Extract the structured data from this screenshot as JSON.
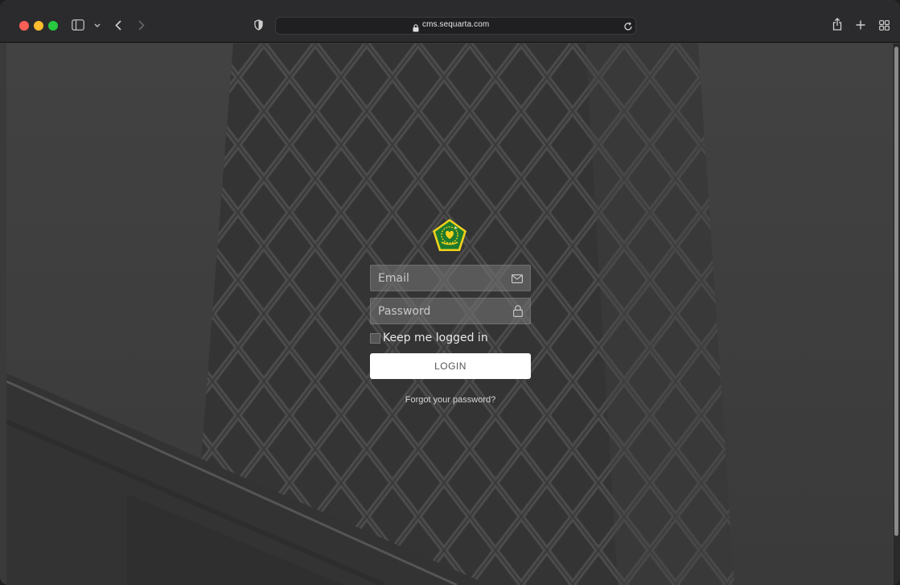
{
  "browser": {
    "url": "cms.sequarta.com"
  },
  "login": {
    "email_placeholder": "Email",
    "password_placeholder": "Password",
    "remember_label": "Keep me logged in",
    "login_label": "LOGIN",
    "forgot_label": "Forgot your password?"
  },
  "icons": {
    "traffic_lights": [
      "close-icon",
      "minimize-icon",
      "zoom-icon"
    ],
    "toolbar": [
      "sidebar-icon",
      "chevron-down-icon",
      "back-icon",
      "forward-icon",
      "privacy-shield-icon",
      "lock-icon",
      "reload-icon",
      "share-icon",
      "new-tab-icon",
      "tab-overview-icon"
    ],
    "fields": [
      "mail-icon",
      "padlock-icon"
    ]
  },
  "colors": {
    "close": "#fe5f57",
    "minimize": "#febc2e",
    "zoom": "#28c840",
    "logo_green": "#1f7a2e",
    "logo_yellow": "#f2d21b"
  }
}
